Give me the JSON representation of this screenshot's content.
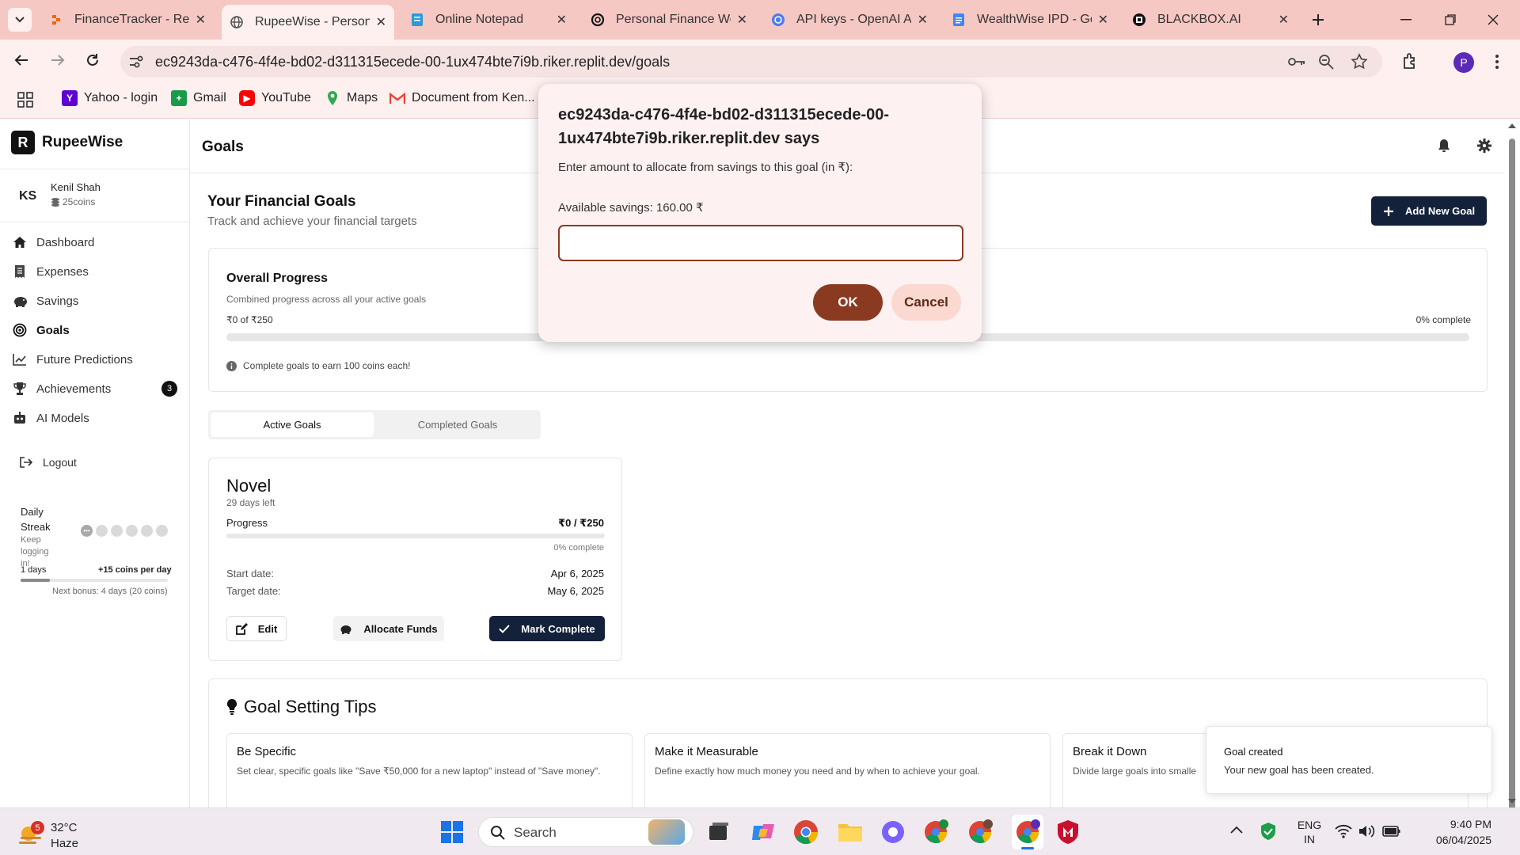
{
  "browser": {
    "tabs": [
      {
        "title": "FinanceTracker - Repl",
        "icon": "replit-icon"
      },
      {
        "title": "RupeeWise - Persona",
        "icon": "globe-icon"
      },
      {
        "title": "Online Notepad",
        "icon": "notepad-icon"
      },
      {
        "title": "Personal Finance We",
        "icon": "openai-icon"
      },
      {
        "title": "API keys - OpenAI AP",
        "icon": "openai-api-icon"
      },
      {
        "title": "WealthWise IPD - Go",
        "icon": "docs-icon"
      },
      {
        "title": "BLACKBOX.AI",
        "icon": "blackbox-icon"
      }
    ],
    "url": "ec9243da-c476-4f4e-bd02-d311315ecede-00-1ux474bte7i9b.riker.replit.dev/goals",
    "profile_initial": "P",
    "bookmarks": [
      "Yahoo - login",
      "Gmail",
      "YouTube",
      "Maps",
      "Document from Ken..."
    ]
  },
  "app": {
    "brand_initial": "R",
    "brand_name": "RupeeWise",
    "page_title": "Goals",
    "user": {
      "initials": "KS",
      "name": "Kenil Shah",
      "coins": "25coins"
    },
    "nav": [
      {
        "label": "Dashboard",
        "icon": "home-icon"
      },
      {
        "label": "Expenses",
        "icon": "receipt-icon"
      },
      {
        "label": "Savings",
        "icon": "piggy-bank-icon"
      },
      {
        "label": "Goals",
        "icon": "target-icon"
      },
      {
        "label": "Future Predictions",
        "icon": "chart-line-icon"
      },
      {
        "label": "Achievements",
        "icon": "trophy-icon",
        "badge": "3"
      },
      {
        "label": "AI Models",
        "icon": "robot-icon"
      }
    ],
    "logout": "Logout",
    "streak": {
      "title": "Daily Streak",
      "subtitle": "Keep logging in!",
      "first_dot": "•••",
      "days": "1 days",
      "bonus_per_day": "+15 coins per day",
      "next_bonus": "Next bonus: 4 days (20 coins)",
      "progress": 0.2
    }
  },
  "goals_page": {
    "heading": "Your Financial Goals",
    "subheading": "Track and achieve your financial targets",
    "add_button": "Add New Goal",
    "overall": {
      "title": "Overall Progress",
      "subtitle": "Combined progress across all your active goals",
      "amount": "₹0 of ₹250",
      "percent_label": "0% complete",
      "progress": 0,
      "info": "Complete goals to earn 100 coins each!"
    },
    "tabs": [
      "Active Goals",
      "Completed Goals"
    ],
    "goal": {
      "name": "Novel",
      "days_left": "29 days left",
      "progress_label": "Progress",
      "progress_value": "₹0 / ₹250",
      "progress": 0,
      "percent_label": "0% complete",
      "start_label": "Start date:",
      "start_value": "Apr 6, 2025",
      "target_label": "Target date:",
      "target_value": "May 6, 2025",
      "edit": "Edit",
      "allocate": "Allocate Funds",
      "complete": "Mark Complete"
    },
    "tips": {
      "heading": "Goal Setting Tips",
      "items": [
        {
          "title": "Be Specific",
          "text": "Set clear, specific goals like \"Save ₹50,000 for a new laptop\" instead of \"Save money\"."
        },
        {
          "title": "Make it Measurable",
          "text": "Define exactly how much money you need and by when to achieve your goal."
        },
        {
          "title": "Break it Down",
          "text": "Divide large goals into smalle"
        }
      ]
    }
  },
  "dialog": {
    "title": "ec9243da-c476-4f4e-bd02-d311315ecede-00-1ux474bte7i9b.riker.replit.dev says",
    "message": "Enter amount to allocate from savings to this goal (in ₹):",
    "savings": "Available savings: 160.00 ₹",
    "input_value": "",
    "ok": "OK",
    "cancel": "Cancel"
  },
  "toast": {
    "title": "Goal created",
    "text": "Your new goal has been created."
  },
  "taskbar": {
    "weather_badge": "5",
    "temp": "32°C",
    "condition": "Haze",
    "search": "Search",
    "lang1": "ENG",
    "lang2": "IN",
    "time": "9:40 PM",
    "date": "06/04/2025"
  },
  "colors": {
    "accent_dark": "#14213a",
    "dialog_ok": "#8b3a22",
    "dialog_cancel": "#fbd9d0",
    "chrome": "#f6c8c4"
  }
}
